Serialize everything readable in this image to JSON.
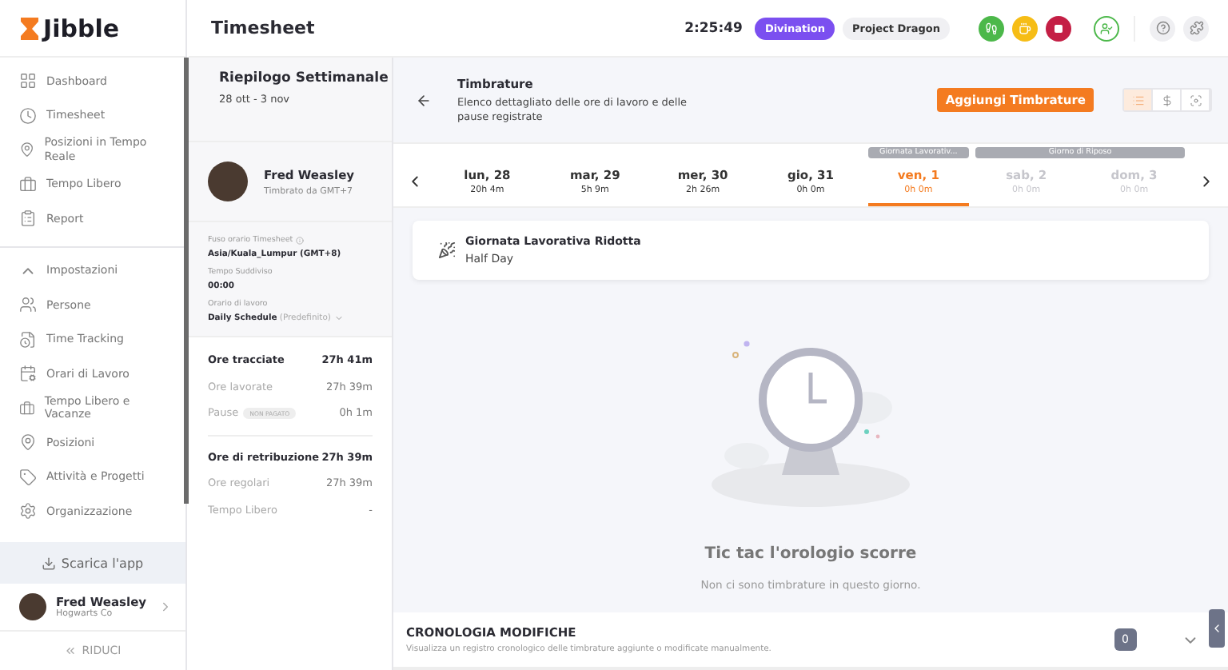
{
  "app": {
    "logo": "Jibble",
    "page_title": "Timesheet"
  },
  "sidebar": {
    "items": [
      {
        "label": "Dashboard",
        "selected": false
      },
      {
        "label": "Timesheet",
        "selected": false
      },
      {
        "label": "Posizioni in Tempo Reale",
        "selected": false
      },
      {
        "label": "Tempo Libero",
        "selected": false
      },
      {
        "label": "Report",
        "selected": false
      }
    ],
    "settings": {
      "label": "Impostazioni",
      "expanded": true
    },
    "settings_items": [
      {
        "label": "Persone"
      },
      {
        "label": "Time Tracking"
      },
      {
        "label": "Orari di Lavoro"
      },
      {
        "label": "Tempo Libero e Vacanze"
      },
      {
        "label": "Posizioni"
      },
      {
        "label": "Attività e Progetti"
      },
      {
        "label": "Organizzazione"
      }
    ],
    "download": "Scarica l'app",
    "user": {
      "name": "Fred Weasley",
      "org": "Hogwarts Co"
    },
    "collapse": "RIDUCI"
  },
  "topbar": {
    "timer": "2:25:49",
    "activity": "Divination",
    "project": "Project Dragon"
  },
  "summary": {
    "title": "Riepilogo Settimanale",
    "range": "28 ott - 3 nov",
    "person": {
      "name": "Fred Weasley",
      "subtitle": "Timbrato da GMT+7"
    },
    "fields": [
      {
        "label": "Fuso orario Timesheet",
        "value": "Asia/Kuala_Lumpur (GMT+8)",
        "info": true
      },
      {
        "label": "Tempo Suddiviso",
        "value": "00:00"
      },
      {
        "label": "Orario di lavoro",
        "value": "Daily Schedule",
        "note": "(Predefinito)",
        "dropdown": true
      }
    ],
    "groups": [
      [
        {
          "label": "Ore tracciate",
          "value": "27h 41m",
          "bold": true
        },
        {
          "label": "Ore lavorate",
          "value": "27h 39m",
          "bold": false
        },
        {
          "label": "Pause",
          "badge": "NON PAGATO",
          "value": "0h 1m",
          "bold": false
        }
      ],
      [
        {
          "label": "Ore di retribuzione",
          "value": "27h 39m",
          "bold": true
        },
        {
          "label": "Ore regolari",
          "value": "27h 39m",
          "bold": false
        },
        {
          "label": "Tempo Libero",
          "value": "-",
          "bold": false
        }
      ]
    ]
  },
  "timbrature": {
    "title": "Timbrature",
    "description": "Elenco dettagliato delle ore di lavoro e delle pause registrate",
    "add_button": "Aggiungi Timbrature",
    "views": [
      {
        "selected": true
      },
      {
        "selected": false
      },
      {
        "selected": false
      }
    ]
  },
  "days": [
    {
      "label": "lun, 28",
      "hours": "20h 4m",
      "selected": false,
      "disabled": false
    },
    {
      "label": "mar, 29",
      "hours": "5h 9m",
      "selected": false,
      "disabled": false
    },
    {
      "label": "mer, 30",
      "hours": "2h 26m",
      "selected": false,
      "disabled": false
    },
    {
      "label": "gio, 31",
      "hours": "0h 0m",
      "selected": false,
      "disabled": false
    },
    {
      "label": "ven, 1",
      "hours": "0h 0m",
      "selected": true,
      "disabled": false,
      "tag": "Giornata Lavorativ..."
    },
    {
      "label": "sab, 2",
      "hours": "0h 0m",
      "selected": false,
      "disabled": true,
      "tag": "Giorno di Riposo",
      "tag_spans_next": true
    },
    {
      "label": "dom, 3",
      "hours": "0h 0m",
      "selected": false,
      "disabled": true
    }
  ],
  "holiday": {
    "title": "Giornata Lavorativa Ridotta",
    "subtitle": "Half Day"
  },
  "empty": {
    "title": "Tic tac l'orologio scorre",
    "message": "Non ci sono timbrature in questo giorno."
  },
  "history": {
    "title": "CRONOLOGIA MODIFICHE",
    "description": "Visualizza un registro cronologico delle timbrature aggiunte o modificate manualmente.",
    "count": "0",
    "expanded": false
  }
}
